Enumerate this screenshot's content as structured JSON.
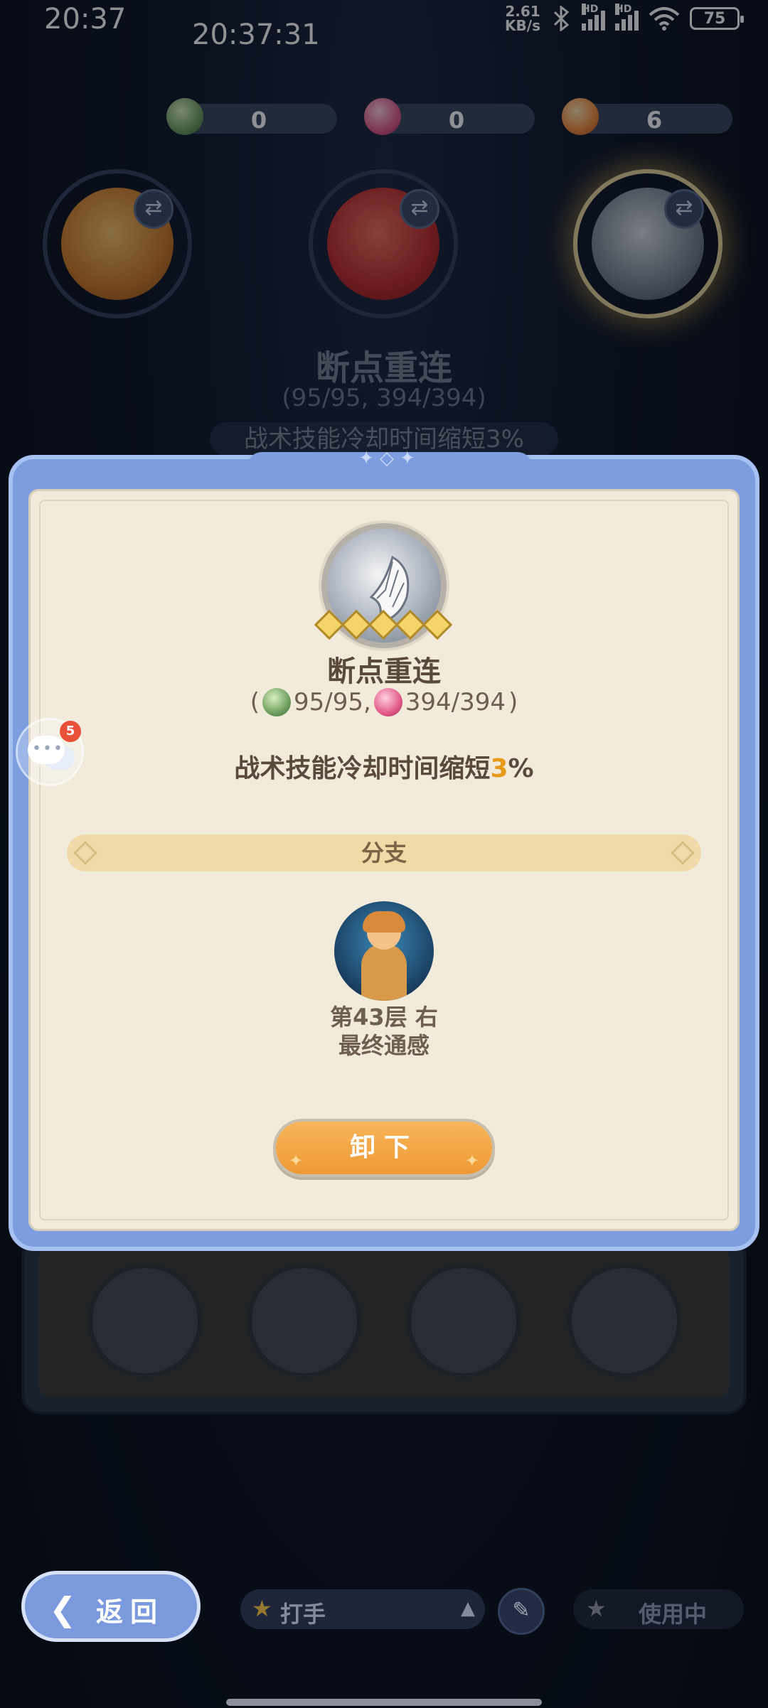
{
  "status_bar": {
    "time": "20:37",
    "net_speed_value": "2.61",
    "net_speed_unit": "KB/s",
    "signal_label": "HD",
    "battery": "75"
  },
  "overlay_clock": "20:37:31",
  "currencies": [
    {
      "name": "green-gem",
      "value": "0"
    },
    {
      "name": "pink-gem",
      "value": "0"
    },
    {
      "name": "orange-gem",
      "value": "6"
    }
  ],
  "background_skill": {
    "title": "断点重连",
    "cost": "(95/95, 394/394)",
    "effect": "战术技能冷却时间缩短3%"
  },
  "dialog": {
    "skill_name": "断点重连",
    "cost_open": "(",
    "cost_green": "95/95,",
    "cost_pink": "394/394",
    "cost_close": ")",
    "effect_prefix": "战术技能冷却时间缩短",
    "effect_value": "3",
    "effect_suffix": "%",
    "branch_label": "分支",
    "branch_line1": "第43层  右",
    "branch_line2": "最终通感",
    "unequip_label": "卸下",
    "stars": 5
  },
  "chat": {
    "badge_count": "5"
  },
  "bottom_bar": {
    "back_label": "返回",
    "preset_label": "打手",
    "in_use_label": "使用中"
  },
  "colors": {
    "dialog_frame": "#7c9ee0",
    "paper": "#f2ebdc",
    "accent_orange": "#ee9a34",
    "highlight_text": "#e69a1a"
  }
}
